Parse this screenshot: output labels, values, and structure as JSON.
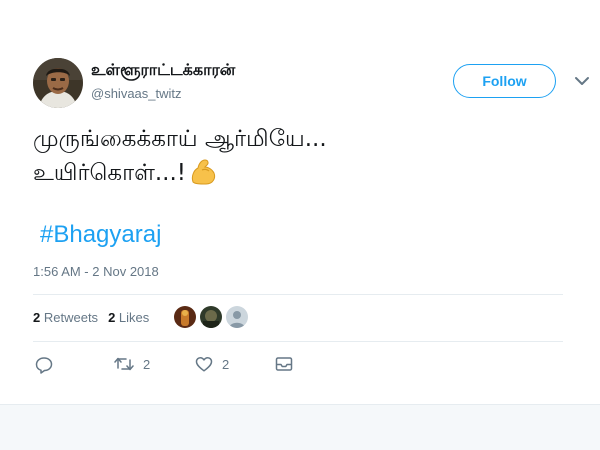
{
  "user": {
    "display_name": "உள்ளூராட்டக்காரன்",
    "handle": "@shivaas_twitz"
  },
  "follow_label": "Follow",
  "tweet": {
    "text_line1": "முருங்கைக்காய் ஆர்மியே...",
    "text_line2": "உயிர்கொள்...!",
    "emoji": "flexed-biceps",
    "hashtag": "#Bhagyaraj",
    "timestamp": "1:56 AM - 2 Nov 2018"
  },
  "stats": {
    "retweets_count": "2",
    "retweets_label": "Retweets",
    "likes_count": "2",
    "likes_label": "Likes"
  },
  "actions": {
    "reply_count": "",
    "retweet_count": "2",
    "like_count": "2"
  },
  "colors": {
    "accent": "#1da1f2",
    "muted": "#657786",
    "text": "#14171a",
    "divider": "#e6ecf0"
  },
  "icons": [
    "reply-icon",
    "retweet-icon",
    "like-icon",
    "message-icon",
    "chevron-down-icon"
  ]
}
